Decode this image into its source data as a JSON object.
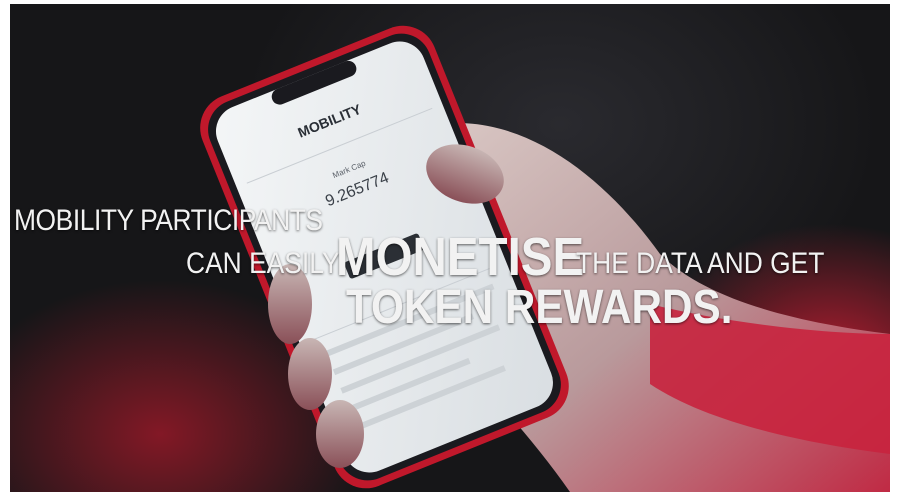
{
  "screen": {
    "app_title": "MOBILITY",
    "metric_label": "Mark Cap",
    "metric_value": "9.265774"
  },
  "caption": {
    "line1": "MOBILITY PARTICIPANTS",
    "line2_pre": "CAN EASILY",
    "line2_emph": "MONETISE",
    "line2_post": "THE DATA AND GET",
    "line3": "TOKEN REWARDS."
  },
  "colors": {
    "phone_frame": "#c0182b",
    "screen": "#e8ecef",
    "glow": "#be1e32"
  }
}
